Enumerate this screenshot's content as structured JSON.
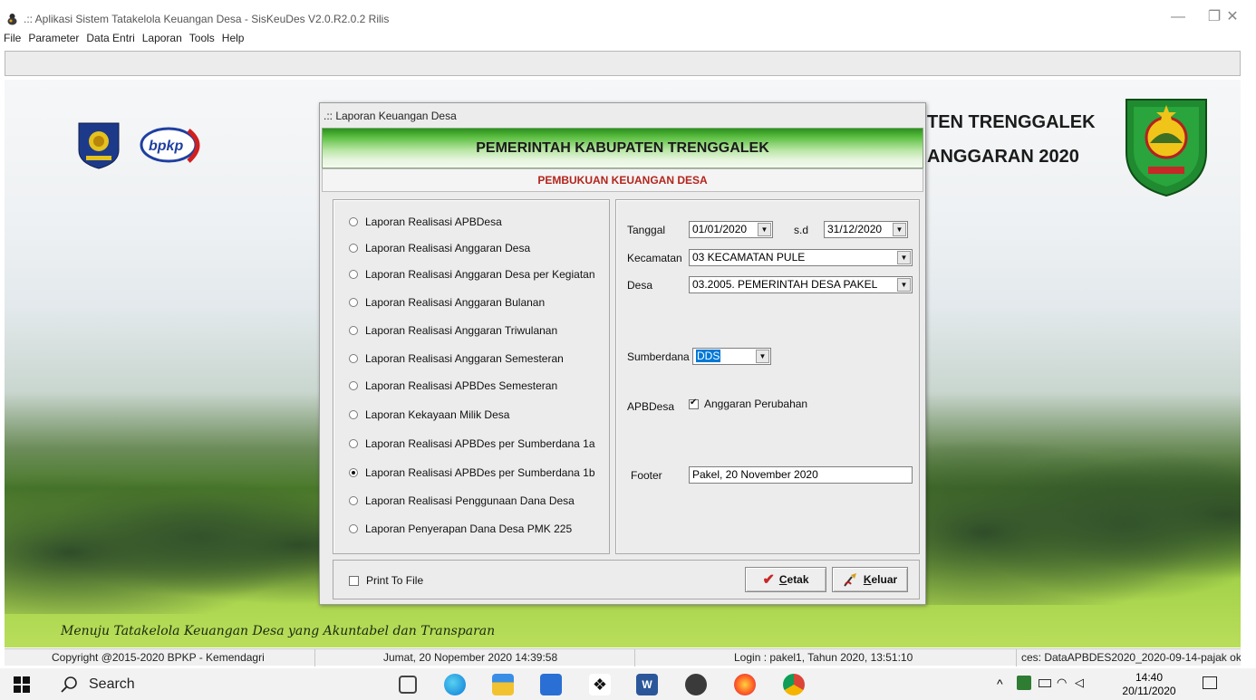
{
  "window": {
    "title": ".:: Aplikasi Sistem Tatakelola Keuangan Desa - SisKeuDes V2.0.R2.0.2 Rilis",
    "controls": {
      "minimize": "—",
      "maximize": "❐",
      "close": "✕"
    }
  },
  "menu": [
    "File",
    "Parameter",
    "Data Entri",
    "Laporan",
    "Tools",
    "Help"
  ],
  "background": {
    "header_line1": "TEN TRENGGALEK",
    "header_line2": "ANGGARAN 2020",
    "bpkp_logo_text": "bpkp",
    "motto": "Menuju Tatakelola Keuangan Desa yang Akuntabel dan Transparan"
  },
  "dialog": {
    "title": ".:: Laporan Keuangan Desa",
    "banner": "PEMERINTAH KABUPATEN TRENGGALEK",
    "subtitle": "PEMBUKUAN KEUANGAN DESA",
    "reports": [
      {
        "label": "Laporan Realisasi APBDesa",
        "checked": false
      },
      {
        "label": "Laporan Realisasi Anggaran Desa",
        "checked": false
      },
      {
        "label": "Laporan Realisasi Anggaran Desa per Kegiatan",
        "checked": false
      },
      {
        "label": "Laporan Realisasi Anggaran Bulanan",
        "checked": false
      },
      {
        "label": "Laporan Realisasi Anggaran Triwulanan",
        "checked": false
      },
      {
        "label": "Laporan Realisasi Anggaran Semesteran",
        "checked": false
      },
      {
        "label": "Laporan Realisasi APBDes Semesteran",
        "checked": false
      },
      {
        "label": "Laporan Kekayaan Milik Desa",
        "checked": false
      },
      {
        "label": "Laporan Realisasi APBDes per Sumberdana 1a",
        "checked": false
      },
      {
        "label": "Laporan Realisasi APBDes per Sumberdana 1b",
        "checked": true
      },
      {
        "label": "Laporan Realisasi Penggunaan Dana Desa",
        "checked": false
      },
      {
        "label": "Laporan Penyerapan Dana Desa PMK 225",
        "checked": false
      }
    ],
    "form": {
      "tanggal_label": "Tanggal",
      "tanggal_from": "01/01/2020",
      "sd_label": "s.d",
      "tanggal_to": "31/12/2020",
      "kecamatan_label": "Kecamatan",
      "kecamatan_value": "03  KECAMATAN PULE",
      "desa_label": "Desa",
      "desa_value": "03.2005.  PEMERINTAH DESA PAKEL",
      "sumberdana_label": "Sumberdana",
      "sumberdana_value": "DDS",
      "apbdesa_label": "APBDesa",
      "anggaran_perubahan_label": "Anggaran Perubahan",
      "anggaran_perubahan_checked": true,
      "footer_label": "Footer",
      "footer_value": "Pakel,  20 November 2020"
    },
    "print_to_file_label": "Print To File",
    "print_to_file_checked": false,
    "buttons": {
      "cetak_first": "C",
      "cetak_rest": "etak",
      "keluar_first": "K",
      "keluar_rest": "eluar"
    }
  },
  "statusbar": {
    "copyright": "Copyright @2015-2020 BPKP - Kemendagri",
    "datetime": "Jumat, 20 Nopember 2020 14:39:58",
    "login": "Login : pakel1,  Tahun 2020, 13:51:10",
    "database": "ces: DataAPBDES2020_2020-09-14-pajak ok"
  },
  "taskbar": {
    "search_label": "Search",
    "clock_time": "14:40",
    "clock_date": "20/11/2020"
  }
}
